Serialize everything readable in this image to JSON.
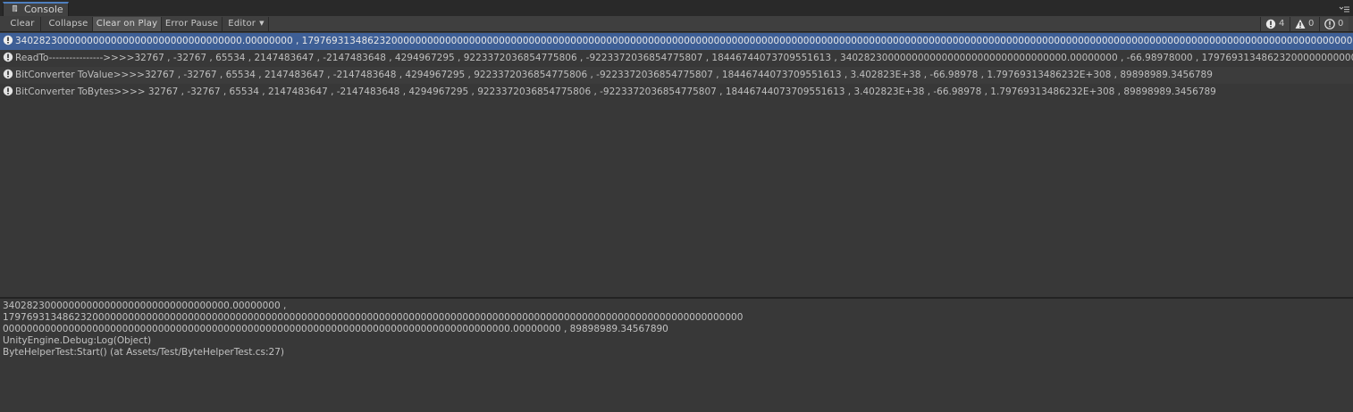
{
  "window": {
    "tab_title": "Console"
  },
  "toolbar": {
    "clear_label": "Clear",
    "collapse_label": "Collapse",
    "clear_on_play_label": "Clear on Play",
    "error_pause_label": "Error Pause",
    "editor_label": "Editor"
  },
  "counters": {
    "info_count": "4",
    "warning_count": "0",
    "error_count": "0"
  },
  "colors": {
    "selected_row": "#3e5f96",
    "tab_accent": "#4e7fbf"
  },
  "log": {
    "entries": [
      {
        "text": "34028230000000000000000000000000000000.00000000  , 17976931348623200000000000000000000000000000000000000000000000000000000000000000000000000000000000000000000000000000000000000000000000000000000000000000000000000000000000000000000000000000000000000000000000000000000000000000000000000000000000000000000000000000000000000000000000.00000000 , 89898989.34567890",
        "icon": "info-icon",
        "selected": true
      },
      {
        "text": "ReadTo---------------->>>>32767 , -32767 , 65534 , 2147483647 , -2147483648 , 4294967295 , 9223372036854775806 , -9223372036854775807 , 18446744073709551613 , 34028230000000000000000000000000000000.00000000 , -66.98978000 , 17976931348623200000000000000000000000000000",
        "icon": "info-icon",
        "selected": false
      },
      {
        "text": "BitConverter ToValue>>>>32767 , -32767 , 65534 , 2147483647 , -2147483648 , 4294967295 , 9223372036854775806 , -9223372036854775807 , 18446744073709551613 , 3.402823E+38 , -66.98978 , 1.79769313486232E+308 , 89898989.3456789",
        "icon": "info-icon",
        "selected": false
      },
      {
        "text": "BitConverter ToBytes>>>>  32767 , -32767 , 65534 , 2147483647 , -2147483648 , 4294967295 , 9223372036854775806 , -9223372036854775807 , 18446744073709551613 , 3.402823E+38 , -66.98978 , 1.79769313486232E+308 , 89898989.3456789",
        "icon": "info-icon",
        "selected": false
      }
    ]
  },
  "detail": {
    "lines": [
      "34028230000000000000000000000000000000.00000000  ,",
      "1797693134862320000000000000000000000000000000000000000000000000000000000000000000000000000000000000000000000000000000000000",
      "0000000000000000000000000000000000000000000000000000000000000000000000000000000000000.00000000 , 89898989.34567890",
      "UnityEngine.Debug:Log(Object)",
      "ByteHelperTest:Start() (at Assets/Test/ByteHelperTest.cs:27)"
    ]
  }
}
